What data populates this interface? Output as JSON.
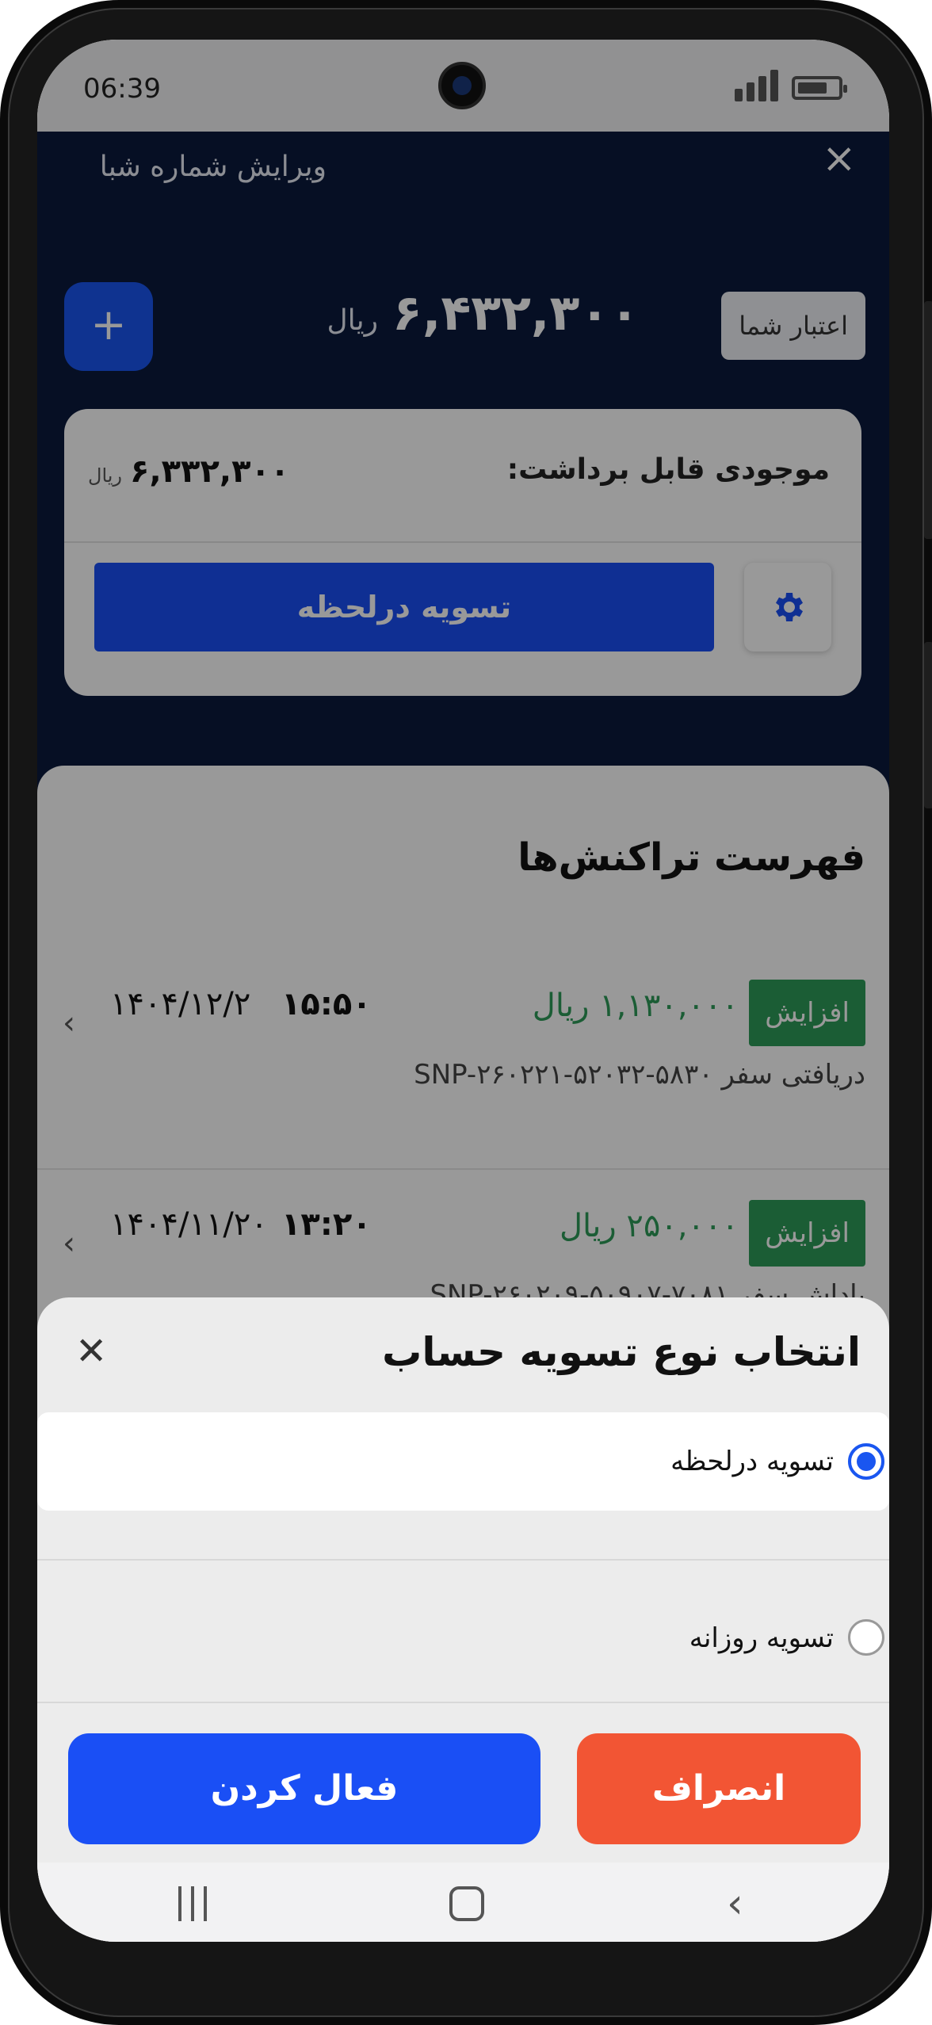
{
  "status_bar": {
    "time": "06:39"
  },
  "header": {
    "title": "ویرایش شماره شبا",
    "credit_label": "اعتبار شما",
    "credit_amount": "۶,۴۳۲,۳۰۰",
    "credit_unit": "ریال",
    "add_label": "+"
  },
  "balance": {
    "label": "موجودی قابل برداشت:",
    "amount": "۶,۳۳۲,۳۰۰",
    "unit": "ریال",
    "settle_button": "تسویه درلحظه"
  },
  "transactions": {
    "title": "فهرست تراکنش‌ها",
    "items": [
      {
        "type": "افزایش",
        "amount": "۱,۱۳۰,۰۰۰ ریال",
        "time": "۱۵:۵۰",
        "date": "۱۴۰۴/۱۲/۲",
        "description": "دریافتی سفر ۵۸۳۰-۵۲۰۳۲-SNP-۲۶۰۲۲۱"
      },
      {
        "type": "افزایش",
        "amount": "۲۵۰,۰۰۰ ریال",
        "time": "۱۳:۲۰",
        "date": "۱۴۰۴/۱۱/۲۰",
        "description": "پاداش سفر ۷۰۸۱-۵۰۹۰۷-SNP-۲۶۰۲۰۹"
      }
    ]
  },
  "sheet": {
    "title": "انتخاب نوع تسویه حساب",
    "options": [
      {
        "label": "تسویه درلحظه",
        "selected": true
      },
      {
        "label": "تسویه روزانه",
        "selected": false
      }
    ],
    "cancel_button": "انصراف",
    "activate_button": "فعال کردن"
  },
  "colors": {
    "primary": "#1a4ff5",
    "danger": "#f25534",
    "success": "#2e9c59",
    "header_bg": "#0b1a3c"
  },
  "icons": [
    "close-icon",
    "plus-icon",
    "gear-icon",
    "chevron-left-icon",
    "radio-icon",
    "nav-recent-icon",
    "nav-home-icon",
    "nav-back-icon",
    "signal-icon",
    "battery-icon"
  ]
}
